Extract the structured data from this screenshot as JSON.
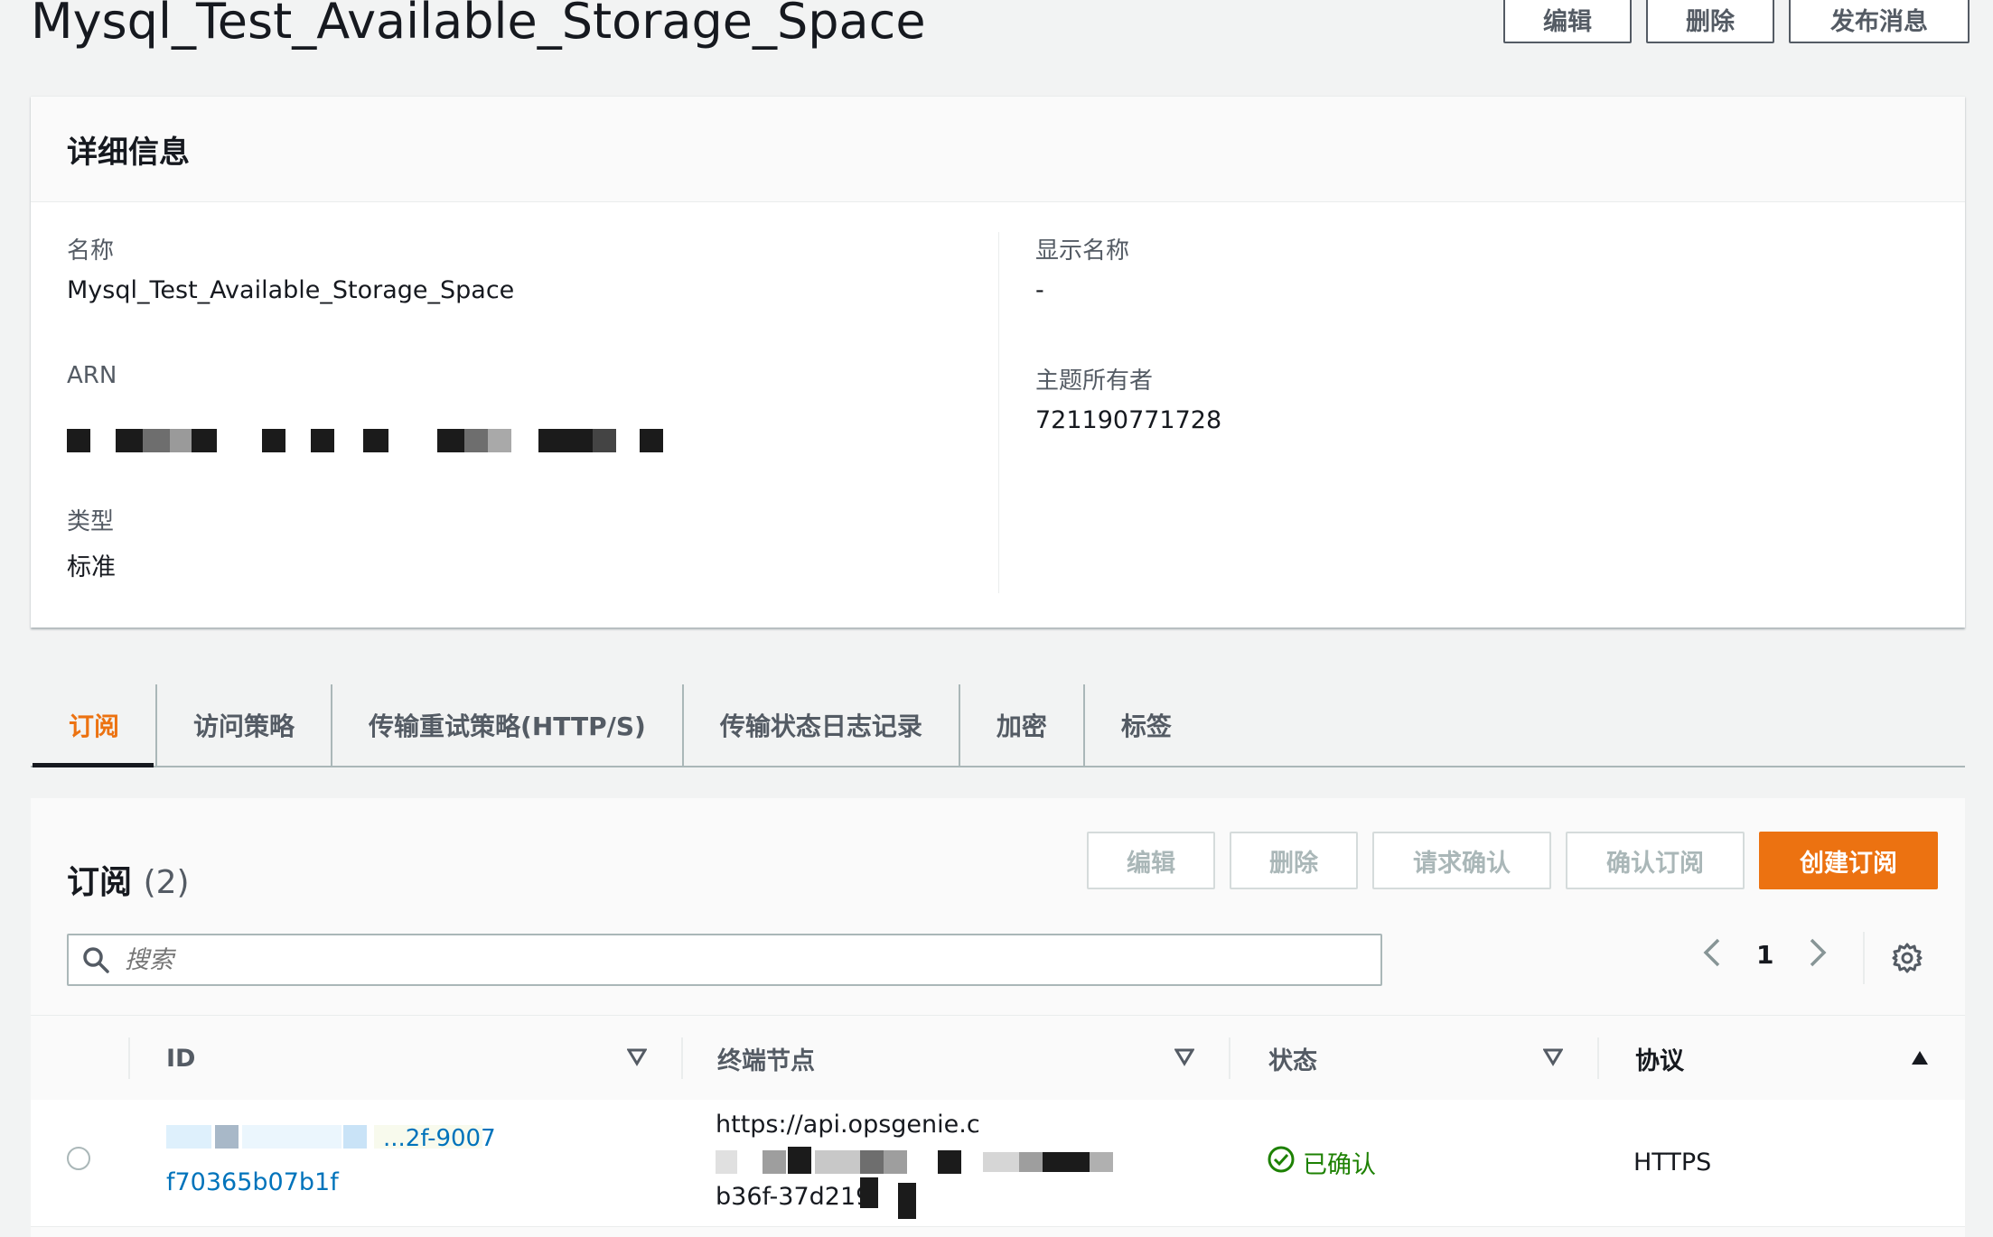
{
  "page": {
    "title": "Mysql_Test_Available_Storage_Space"
  },
  "top_actions": [
    "编辑",
    "删除",
    "发布消息"
  ],
  "details": {
    "title": "详细信息",
    "name_label": "名称",
    "name_value": "Mysql_Test_Available_Storage_Space",
    "arn_label": "ARN",
    "type_label": "类型",
    "type_value": "标准",
    "display_name_label": "显示名称",
    "display_name_value": "-",
    "owner_label": "主题所有者",
    "owner_value": "721190771728"
  },
  "tabs": [
    "订阅",
    "访问策略",
    "传输重试策略(HTTP/S)",
    "传输状态日志记录",
    "加密",
    "标签"
  ],
  "subscriptions": {
    "title": "订阅",
    "count": "(2)",
    "actions": {
      "edit": "编辑",
      "delete": "删除",
      "request_confirm": "请求确认",
      "confirm": "确认订阅",
      "create": "创建订阅"
    },
    "search_placeholder": "搜索",
    "page_number": "1",
    "columns": {
      "id": "ID",
      "endpoint": "终端节点",
      "status": "状态",
      "protocol": "协议"
    },
    "rows": [
      {
        "id_line1": "...2f-9007",
        "id_line2": "f70365b07b1f",
        "endpoint_line1": "https://api.opsgenie.c",
        "endpoint_line3": "b36f-37d219",
        "status": "已确认",
        "protocol": "HTTPS"
      }
    ]
  },
  "colors": {
    "accent": "#ec7211",
    "link": "#0073bb",
    "success": "#1d8102"
  }
}
